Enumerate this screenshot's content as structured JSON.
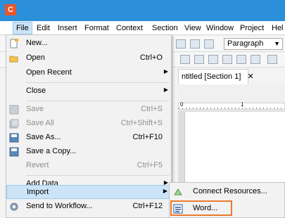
{
  "app": {
    "logo_letter": "C"
  },
  "menubar": {
    "items": [
      {
        "label": "File"
      },
      {
        "label": "Edit"
      },
      {
        "label": "Insert"
      },
      {
        "label": "Format"
      },
      {
        "label": "Context"
      },
      {
        "label": "Section"
      },
      {
        "label": "View"
      },
      {
        "label": "Window"
      },
      {
        "label": "Project"
      },
      {
        "label": "Hel"
      }
    ]
  },
  "toolbar": {
    "paragraph_style": "Paragraph"
  },
  "document": {
    "tab_title": "ntitled [Section 1]",
    "tab_close": "✕",
    "ruler_mark": "1",
    "ruler_zero": "0"
  },
  "file_menu": {
    "new": {
      "label": "New..."
    },
    "open": {
      "label": "Open",
      "shortcut": "Ctrl+O"
    },
    "open_recent": {
      "label": "Open Recent"
    },
    "close": {
      "label": "Close"
    },
    "save": {
      "label": "Save",
      "shortcut": "Ctrl+S"
    },
    "save_all": {
      "label": "Save All",
      "shortcut": "Ctrl+Shift+S"
    },
    "save_as": {
      "label": "Save As...",
      "shortcut": "Ctrl+F10"
    },
    "save_copy": {
      "label": "Save a Copy..."
    },
    "revert": {
      "label": "Revert",
      "shortcut": "Ctrl+F5"
    },
    "add_data": {
      "label": "Add Data"
    },
    "import": {
      "label": "Import"
    },
    "send_workflow": {
      "label": "Send to Workflow...",
      "shortcut": "Ctrl+F12"
    }
  },
  "import_submenu": {
    "connect_resources": {
      "label": "Connect Resources..."
    },
    "word": {
      "label": "Word..."
    }
  },
  "colors": {
    "titlebar": "#2c8fd9",
    "highlight": "#cce4f7",
    "callout": "#ec7b2f"
  }
}
